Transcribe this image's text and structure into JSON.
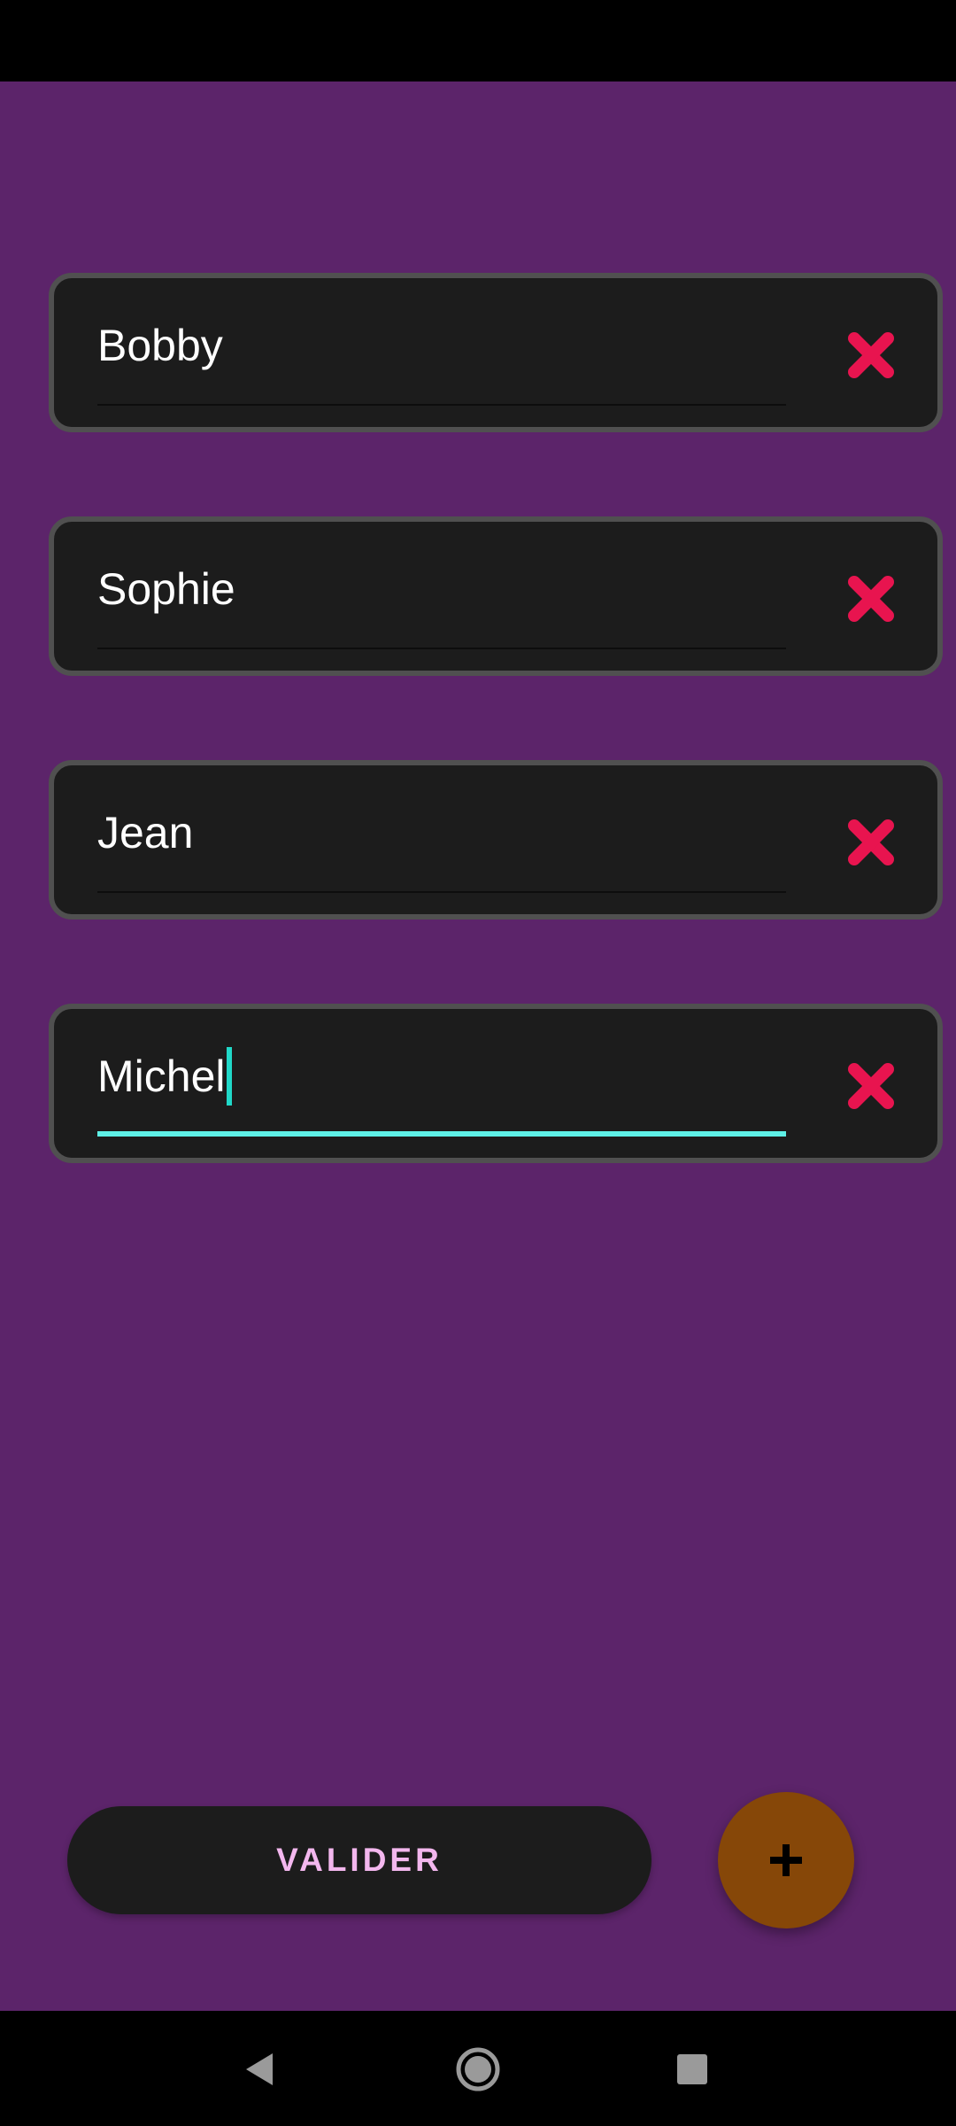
{
  "names": [
    {
      "value": "Bobby",
      "focused": false
    },
    {
      "value": "Sophie",
      "focused": false
    },
    {
      "value": "Jean",
      "focused": false
    },
    {
      "value": "Michel",
      "focused": true
    }
  ],
  "actions": {
    "validate_label": "VALIDER",
    "add_icon": "plus-icon"
  },
  "icons": {
    "delete": "close-icon",
    "nav_back": "back-triangle-icon",
    "nav_home": "home-circle-icon",
    "nav_recents": "recents-square-icon"
  },
  "colors": {
    "background": "#5c246a",
    "card": "#1c1c1c",
    "card_border": "#505050",
    "delete_red": "#e8144f",
    "focus_accent": "#5ef0e6",
    "button_text": "#f3b7ee",
    "fab": "#864708"
  }
}
